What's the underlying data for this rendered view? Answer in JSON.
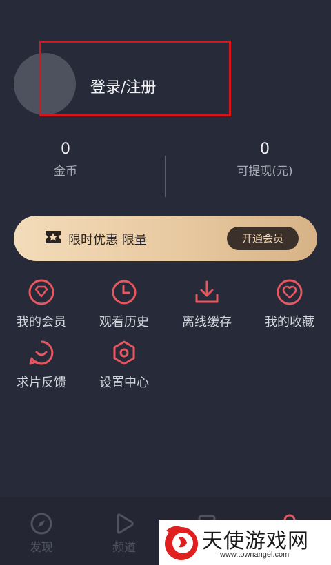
{
  "profile": {
    "login_label": "登录/注册"
  },
  "stats": {
    "coins": {
      "value": "0",
      "label": "金币"
    },
    "withdrawable": {
      "value": "0",
      "label": "可提现(元)"
    }
  },
  "vip": {
    "promo_text": "限时优惠 限量",
    "button_label": "开通会员"
  },
  "menu": {
    "items": [
      {
        "label": "我的会员",
        "icon": "diamond-icon"
      },
      {
        "label": "观看历史",
        "icon": "clock-icon"
      },
      {
        "label": "离线缓存",
        "icon": "download-icon"
      },
      {
        "label": "我的收藏",
        "icon": "heart-icon"
      },
      {
        "label": "求片反馈",
        "icon": "chat-smile-icon"
      },
      {
        "label": "设置中心",
        "icon": "hexagon-settings-icon"
      }
    ]
  },
  "bottom_nav": {
    "items": [
      {
        "label": "发现",
        "icon": "compass-icon"
      },
      {
        "label": "频道",
        "icon": "play-icon"
      },
      {
        "label": "",
        "icon": "square-icon"
      },
      {
        "label": "",
        "icon": "user-icon"
      }
    ]
  },
  "watermark": {
    "title": "天使游戏网",
    "url": "www.townangel.com"
  },
  "colors": {
    "background": "#272a38",
    "accent_red": "#e8575f",
    "vip_gold": "#e8c9a0",
    "highlight_box": "#d8151b"
  }
}
